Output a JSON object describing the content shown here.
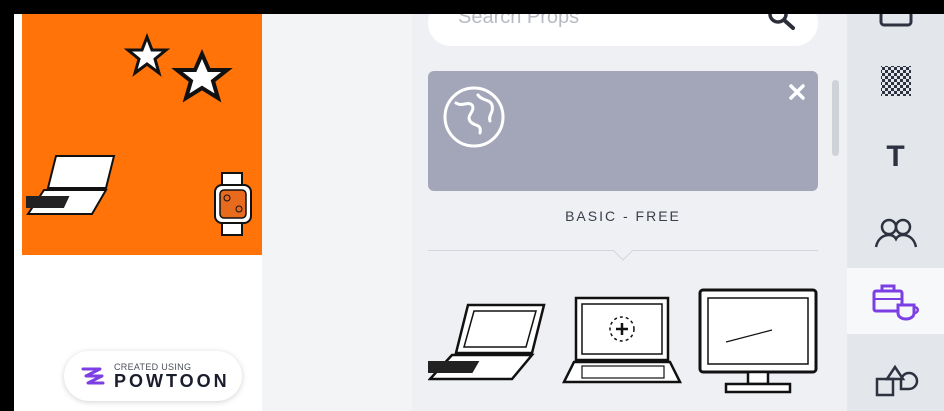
{
  "search": {
    "placeholder": "Search Props",
    "icon": "search-icon"
  },
  "category": {
    "label": "BASIC - FREE",
    "icon": "globe-icon",
    "close_icon": "close-icon"
  },
  "props": [
    {
      "name": "laptop-prop"
    },
    {
      "name": "laptop-add-prop"
    },
    {
      "name": "monitor-prop"
    }
  ],
  "preview": {
    "badge_small": "CREATED USING",
    "badge_big": "POWTOON",
    "accent": "#ff7309"
  },
  "rail": {
    "text_tool_label": "T",
    "items": [
      "shapes-icon",
      "texture-icon",
      "text-icon",
      "characters-icon",
      "props-icon",
      "shapes-icon"
    ],
    "active": "props-icon"
  },
  "colors": {
    "accent": "#ff7309",
    "card": "#a2a6b8",
    "panel": "#eef0f3"
  }
}
